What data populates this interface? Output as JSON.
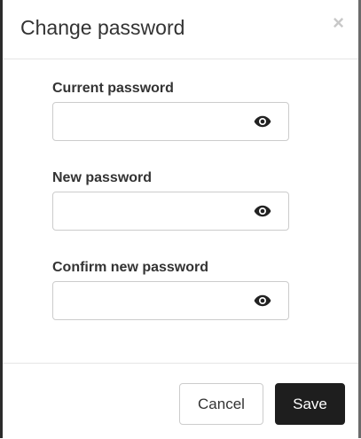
{
  "dialog": {
    "title": "Change password",
    "close_icon": "close-icon"
  },
  "fields": [
    {
      "label": "Current password",
      "value": "",
      "icon": "eye-icon"
    },
    {
      "label": "New password",
      "value": "",
      "icon": "eye-icon"
    },
    {
      "label": "Confirm new password",
      "value": "",
      "icon": "eye-icon"
    }
  ],
  "footer": {
    "cancel_label": "Cancel",
    "save_label": "Save"
  },
  "colors": {
    "save_button_bg": "#1e1e1e",
    "title_text": "#333333",
    "border": "#cccccc"
  }
}
